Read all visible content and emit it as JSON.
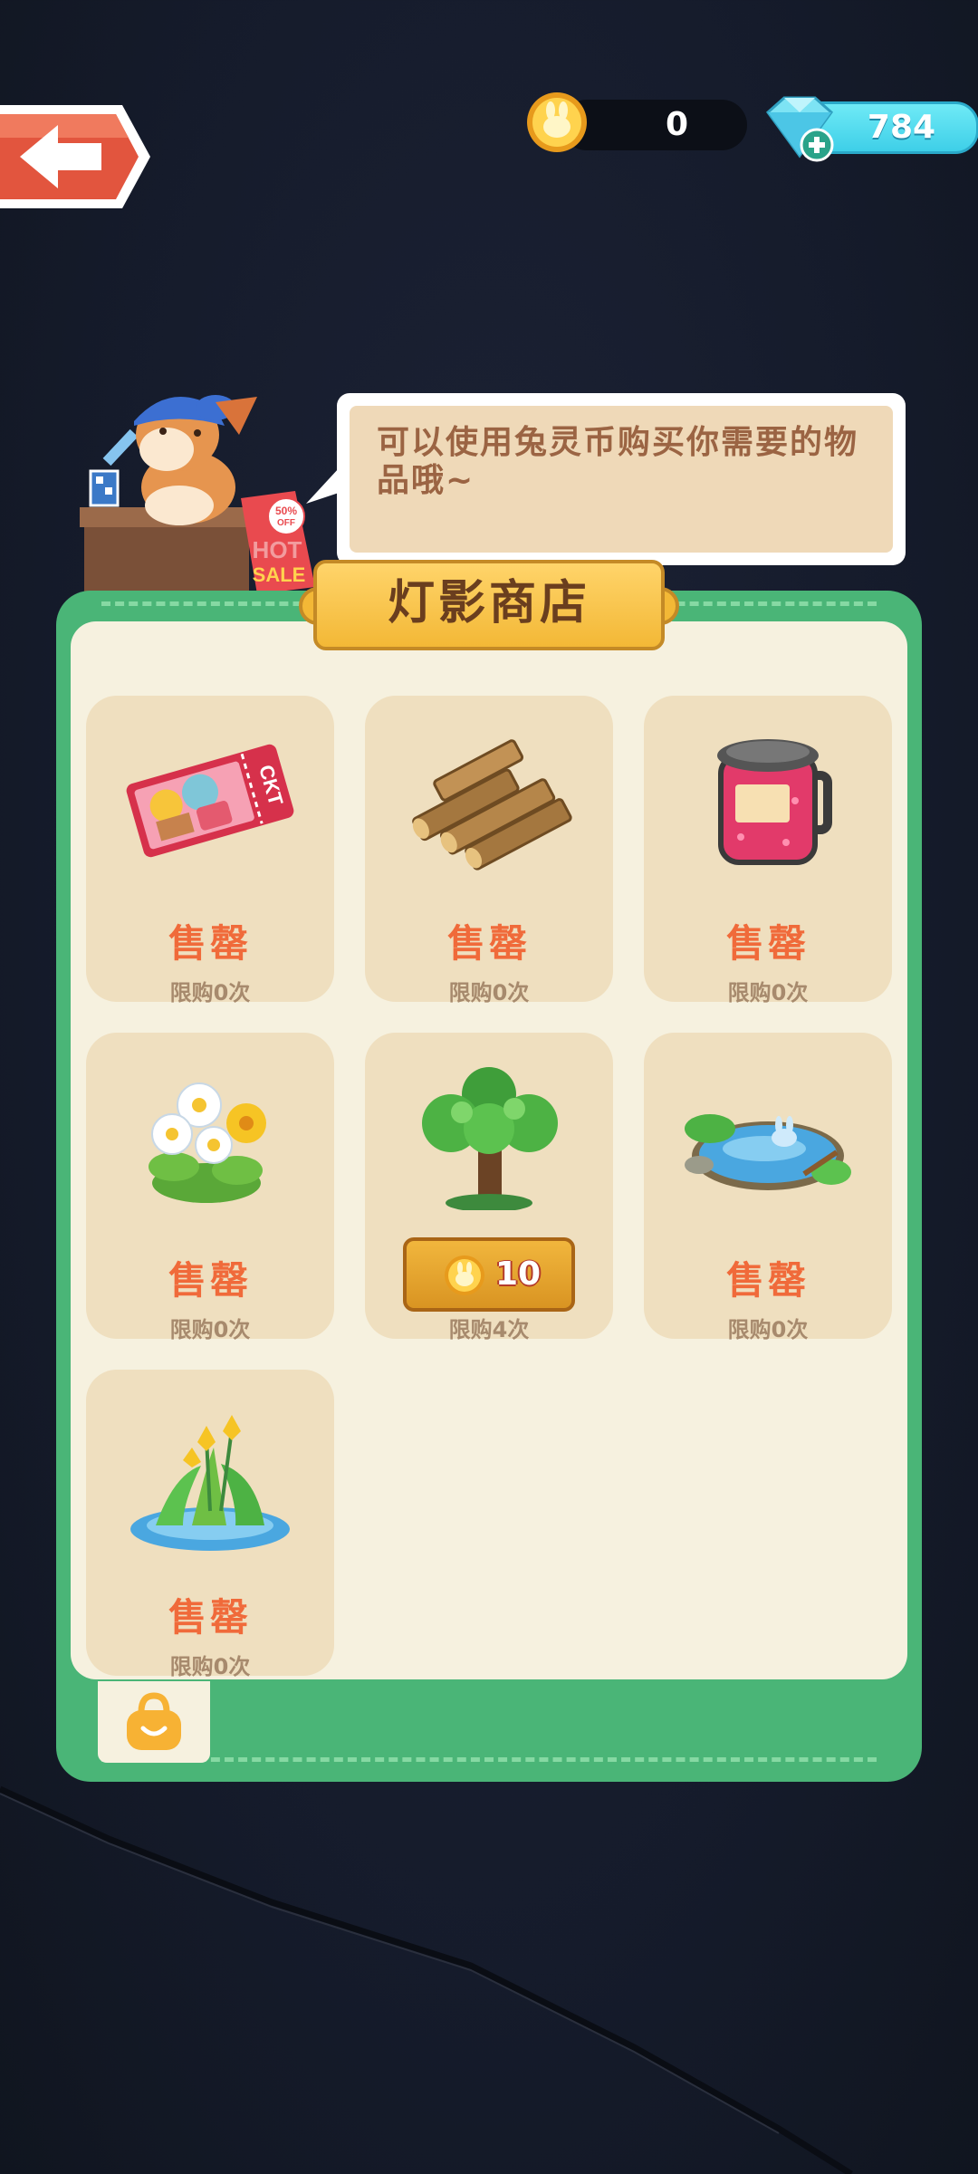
{
  "currency": {
    "coins": "0",
    "gems": "784"
  },
  "npc": {
    "dialog": "可以使用兔灵币购买你需要的物品哦~",
    "sign": {
      "line1": "50%",
      "line2": "OFF",
      "line3": "HOT",
      "line4": "SALE"
    }
  },
  "shop": {
    "title": "灯影商店",
    "items": [
      {
        "name": "ticket",
        "status": "售罄",
        "limit": "限购0次",
        "icon": "ticket-icon"
      },
      {
        "name": "wood",
        "status": "售罄",
        "limit": "限购0次",
        "icon": "wood-logs-icon"
      },
      {
        "name": "jam-jar",
        "status": "售罄",
        "limit": "限购0次",
        "icon": "jam-jar-icon"
      },
      {
        "name": "flowers",
        "status": "售罄",
        "limit": "限购0次",
        "icon": "daisy-flowers-icon"
      },
      {
        "name": "tree",
        "price": "10",
        "limit": "限购4次",
        "icon": "tree-icon"
      },
      {
        "name": "pond",
        "status": "售罄",
        "limit": "限购0次",
        "icon": "pond-icon"
      },
      {
        "name": "lily-pond",
        "status": "售罄",
        "limit": "限购0次",
        "icon": "yellow-lily-icon"
      }
    ]
  },
  "colors": {
    "panel_green": "#4ab577",
    "panel_inner": "#f6f1df",
    "card_bg": "#efdfbf",
    "sold_out_text": "#f06a3a",
    "title_gold": "#f3b836"
  }
}
